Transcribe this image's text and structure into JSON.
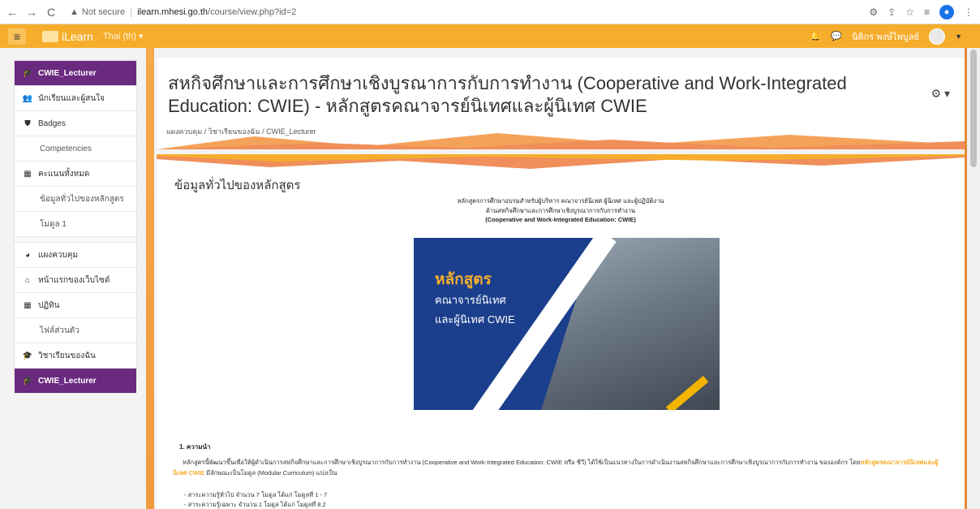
{
  "browser": {
    "back": "←",
    "forward": "→",
    "reload": "C",
    "security_label": "Not secure",
    "url_host": "ilearn.mhesi.go.th",
    "url_path": "/course/view.php?id=2"
  },
  "navbar": {
    "brand": "iLearn",
    "language": "Thai (th) ▾",
    "user_name": "นิติกร พงษ์ไพบูลย์"
  },
  "drawer": {
    "items": [
      {
        "label": "CWIE_Lecturer",
        "icon": "graduation-cap-icon",
        "glyph": "🎓"
      },
      {
        "label": "นักเรียนและผู้สนใจ",
        "icon": "users-icon",
        "glyph": "👥"
      },
      {
        "label": "Badges",
        "icon": "shield-icon",
        "glyph": "⛊"
      },
      {
        "label": "Competencies",
        "icon": "none",
        "glyph": ""
      },
      {
        "label": "คะแนนทั้งหมด",
        "icon": "table-icon",
        "glyph": "▦"
      },
      {
        "label": "ข้อมูลทั่วไปของหลักสูตร",
        "icon": "none",
        "glyph": ""
      },
      {
        "label": "โมดูล 1",
        "icon": "none",
        "glyph": ""
      },
      {
        "label": "แผงควบคุม",
        "icon": "dashboard-icon",
        "glyph": "◕"
      },
      {
        "label": "หน้าแรกของเว็บไซต์",
        "icon": "home-icon",
        "glyph": "⌂"
      },
      {
        "label": "ปฏิทิน",
        "icon": "calendar-icon",
        "glyph": "▦"
      },
      {
        "label": "ไฟล์ส่วนตัว",
        "icon": "none",
        "glyph": ""
      },
      {
        "label": "วิชาเรียนของฉัน",
        "icon": "graduation-cap-icon",
        "glyph": "🎓"
      },
      {
        "label": "CWIE_Lecturer",
        "icon": "graduation-cap-icon",
        "glyph": "🎓"
      }
    ]
  },
  "header": {
    "title": "สหกิจศึกษาและการศึกษาเชิงบูรณาการกับการทำงาน (Cooperative and Work-Integrated Education: CWIE) - หลักสูตรคณาจารย์นิเทศและผู้นิเทศ CWIE",
    "breadcrumb": [
      "แผงควบคุม",
      "วิชาเรียนของฉัน",
      "CWIE_Lecturer"
    ],
    "settings_icon": "gear-icon"
  },
  "content": {
    "section_title": "ข้อมูลทั่วไปของหลักสูตร",
    "intro_lines": [
      "หลักสูตรการศึกษาอบรมสำหรับผู้บริหาร คณาจารย์นิเทศ ผู้นิเทศ และผู้ปฏิบัติงาน",
      "ด้านสหกิจศึกษาและการศึกษาเชิงบูรณาการกับการทำงาน",
      "(Cooperative and Work-Integrated Education: CWIE)"
    ],
    "banner": {
      "line1": "หลักสูตร",
      "line2": "คณาจารย์นิเทศ",
      "line3": "และผู้นิเทศ CWIE"
    },
    "principle_heading": "1. ความนำ",
    "paragraph_before": "หลักสูตรนี้พัฒนาขึ้นเพื่อให้ผู้ดำเนินการสหกิจศึกษาและการศึกษาเชิงบูรณาการกับการทำงาน (Cooperative and Work-Integrated Education: CWIE หรือ ซีวี) ได้ใช้เป็นแนวทางในการดำเนินงานสหกิจศึกษาและการศึกษาเชิงบูรณาการกับการทำงาน ขององค์กร โดย",
    "paragraph_highlight": "หลักสูตรคณาจารย์นิเทศและผู้นิเทศ CWIE",
    "paragraph_after": " มีลักษณะเป็นโมดูล (Modular Curriculum) แบ่งเป็น",
    "bullets": [
      "- สาระความรู้ทั่วไป จำนวน 7 โมดูล ได้แก่ โมดูลที่ 1 - 7",
      "- สาระความรู้เฉพาะ จำนวน 1 โมดูล ได้แก่ โมดูลที่ 8.2"
    ]
  },
  "colors": {
    "navbar": "#f6ad2c",
    "drawer_active": "#6a2a7f",
    "banner_blue": "#1b3f8c",
    "highlight": "#f6ad2c"
  }
}
